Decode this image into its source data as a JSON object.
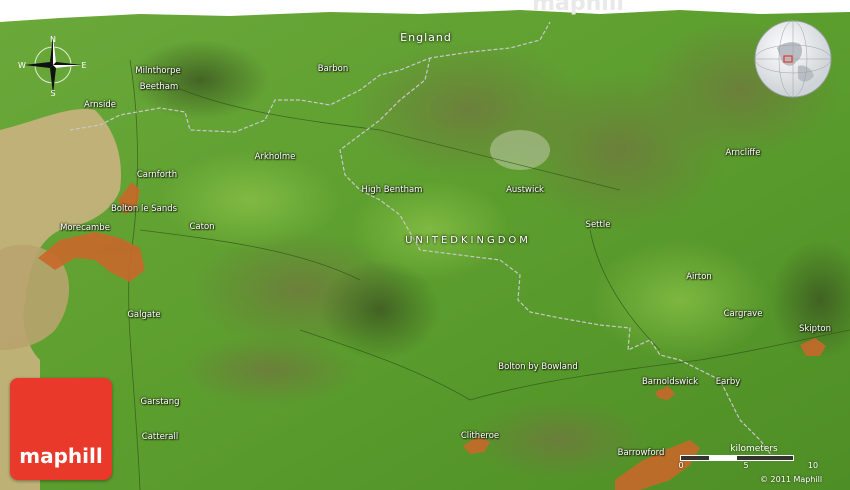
{
  "map": {
    "region_label": "England",
    "country_label": "UNITEDKINGDOM",
    "places": [
      {
        "name": "Milnthorpe"
      },
      {
        "name": "Beetham"
      },
      {
        "name": "Arnside"
      },
      {
        "name": "Barbon"
      },
      {
        "name": "Arkholme"
      },
      {
        "name": "Carnforth"
      },
      {
        "name": "Bolton le Sands"
      },
      {
        "name": "High Bentham"
      },
      {
        "name": "Austwick"
      },
      {
        "name": "Arncliffe"
      },
      {
        "name": "Morecambe"
      },
      {
        "name": "Caton"
      },
      {
        "name": "Settle"
      },
      {
        "name": "Airton"
      },
      {
        "name": "Galgate"
      },
      {
        "name": "Cargrave"
      },
      {
        "name": "Skipton"
      },
      {
        "name": "Bolton by Bowland"
      },
      {
        "name": "Barnoldswick"
      },
      {
        "name": "Earby"
      },
      {
        "name": "Garstang"
      },
      {
        "name": "Catterall"
      },
      {
        "name": "Clitheroe"
      },
      {
        "name": "Barrowford"
      }
    ]
  },
  "compass": {
    "n": "N",
    "s": "S",
    "w": "W",
    "e": "E"
  },
  "brand": {
    "logo_text": "maphill",
    "top_text": "maphill"
  },
  "scale": {
    "unit": "kilometers",
    "ticks": [
      "0",
      "5",
      "10"
    ]
  },
  "copyright": "© 2011 Maphill",
  "colors": {
    "land": "#5a9a2e",
    "urban": "#c8682a",
    "logo": "#e8392b",
    "border": "#c8c8c8"
  }
}
